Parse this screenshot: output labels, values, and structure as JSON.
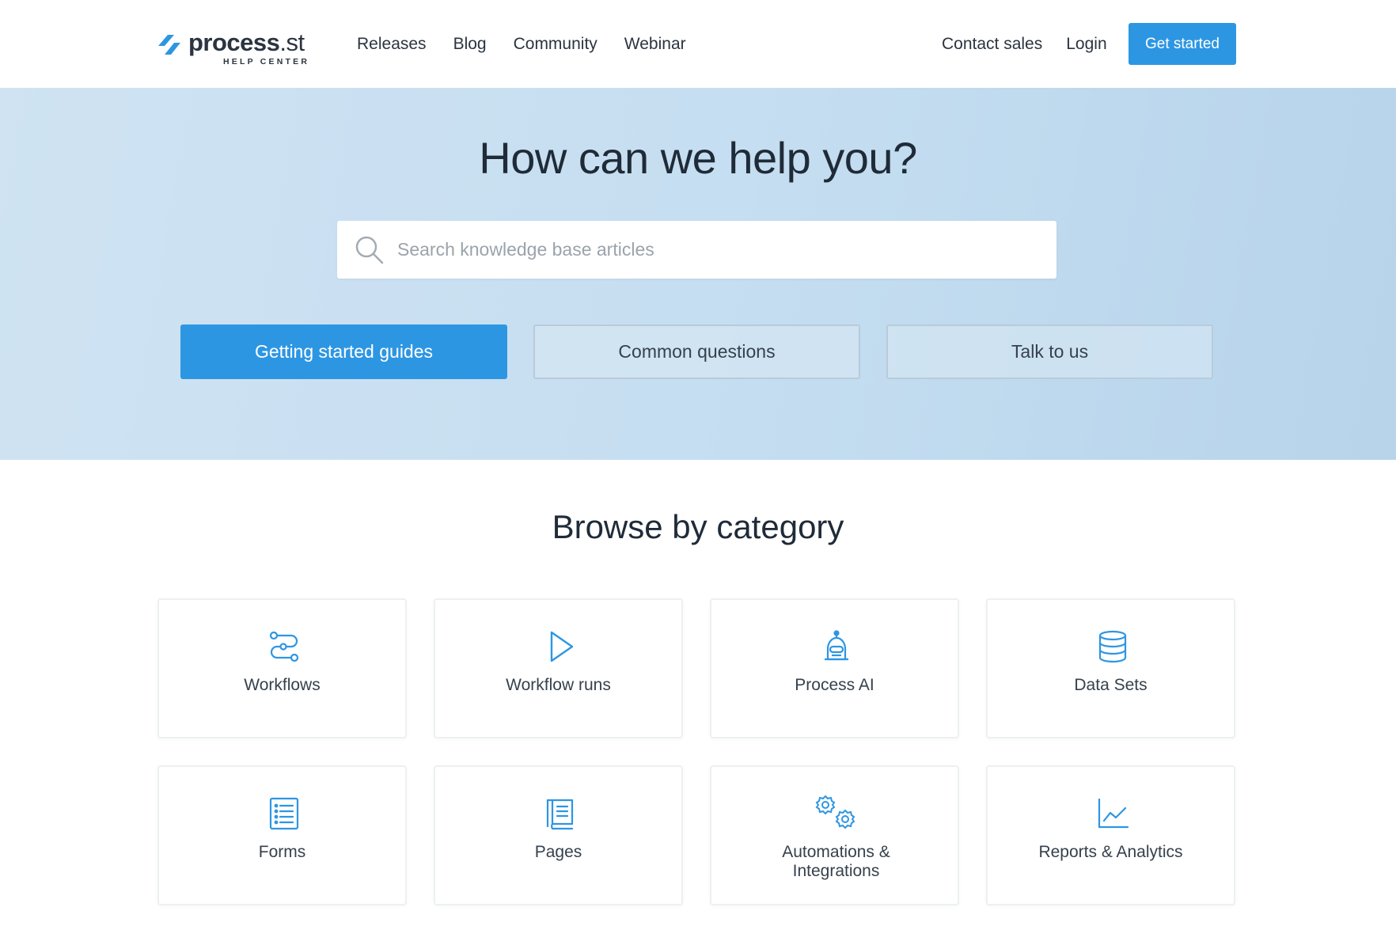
{
  "header": {
    "logo": {
      "word": "process",
      "suffix": ".st",
      "sub": "HELP CENTER"
    },
    "nav_left": [
      "Releases",
      "Blog",
      "Community",
      "Webinar"
    ],
    "nav_right": [
      "Contact sales",
      "Login"
    ],
    "cta_label": "Get started"
  },
  "hero": {
    "title": "How can we help you?",
    "search_placeholder": "Search knowledge base articles",
    "buttons": [
      "Getting started guides",
      "Common questions",
      "Talk to us"
    ]
  },
  "browse": {
    "title": "Browse by category",
    "categories": [
      {
        "label": "Workflows",
        "icon": "workflow-icon"
      },
      {
        "label": "Workflow runs",
        "icon": "play-icon"
      },
      {
        "label": "Process AI",
        "icon": "robot-icon"
      },
      {
        "label": "Data Sets",
        "icon": "database-icon"
      },
      {
        "label": "Forms",
        "icon": "form-list-icon"
      },
      {
        "label": "Pages",
        "icon": "book-icon"
      },
      {
        "label": "Automations & Integrations",
        "icon": "gears-icon"
      },
      {
        "label": "Reports & Analytics",
        "icon": "line-chart-icon"
      }
    ]
  },
  "colors": {
    "accent": "#2d96e3",
    "hero_bg": "#c6def1",
    "text": "#1f2b38"
  }
}
